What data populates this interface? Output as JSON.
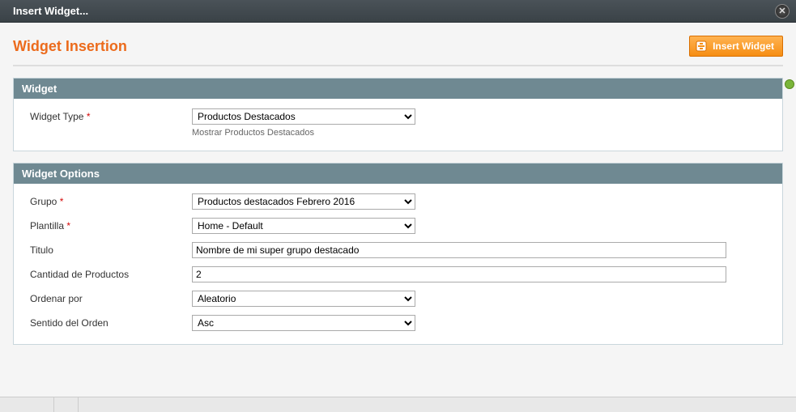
{
  "titlebar": {
    "title": "Insert Widget..."
  },
  "header": {
    "page_title": "Widget Insertion",
    "insert_button": "Insert Widget"
  },
  "section_widget": {
    "heading": "Widget",
    "type_label": "Widget Type",
    "type_value": "Productos Destacados",
    "type_help": "Mostrar Productos Destacados"
  },
  "section_options": {
    "heading": "Widget Options",
    "grupo_label": "Grupo",
    "grupo_value": "Productos destacados Febrero 2016",
    "plantilla_label": "Plantilla",
    "plantilla_value": "Home - Default",
    "titulo_label": "Titulo",
    "titulo_value": "Nombre de mi super grupo destacado",
    "cantidad_label": "Cantidad de Productos",
    "cantidad_value": "2",
    "ordenar_label": "Ordenar por",
    "ordenar_value": "Aleatorio",
    "sentido_label": "Sentido del Orden",
    "sentido_value": "Asc"
  },
  "required_marker": "*"
}
